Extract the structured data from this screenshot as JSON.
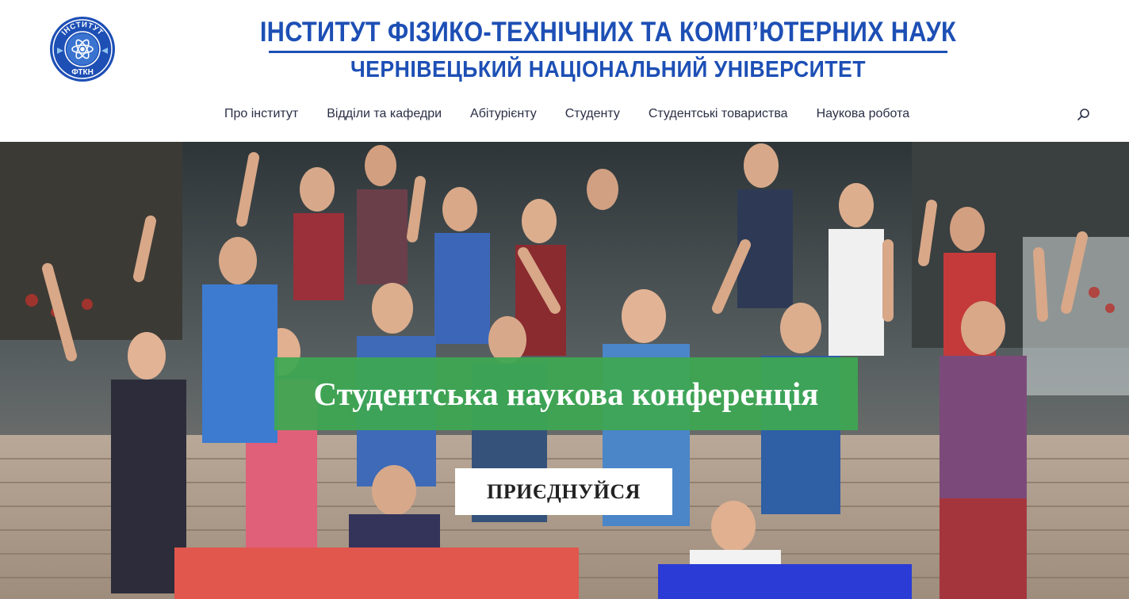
{
  "header": {
    "logo": {
      "top_text": "ІНСТИТУТ",
      "bottom_text": "ФТКН",
      "icon": "institute-emblem",
      "colors": {
        "background": "#1d4fb5",
        "ring": "#ffffff",
        "accent": "#8fc3ef"
      }
    },
    "title_main": "ІНСТИТУТ ФІЗИКО-ТЕХНІЧНИХ ТА КОМП’ЮТЕРНИХ НАУК",
    "title_sub": "ЧЕРНІВЕЦЬКИЙ НАЦІОНАЛЬНИЙ УНІВЕРСИТЕТ",
    "brand_color": "#1d4fb5"
  },
  "nav": {
    "items": [
      {
        "label": "Про інститут"
      },
      {
        "label": "Відділи та кафедри"
      },
      {
        "label": "Абітурієнту"
      },
      {
        "label": "Студенту"
      },
      {
        "label": "Студентські товариства"
      },
      {
        "label": "Наукова робота"
      }
    ],
    "search_icon": "search-icon"
  },
  "hero": {
    "caption": "Студентська наукова конференція",
    "button_label": "ПРИЄДНУЙСЯ",
    "caption_color": "#3da852",
    "photo": "group-photo-waving-students"
  }
}
